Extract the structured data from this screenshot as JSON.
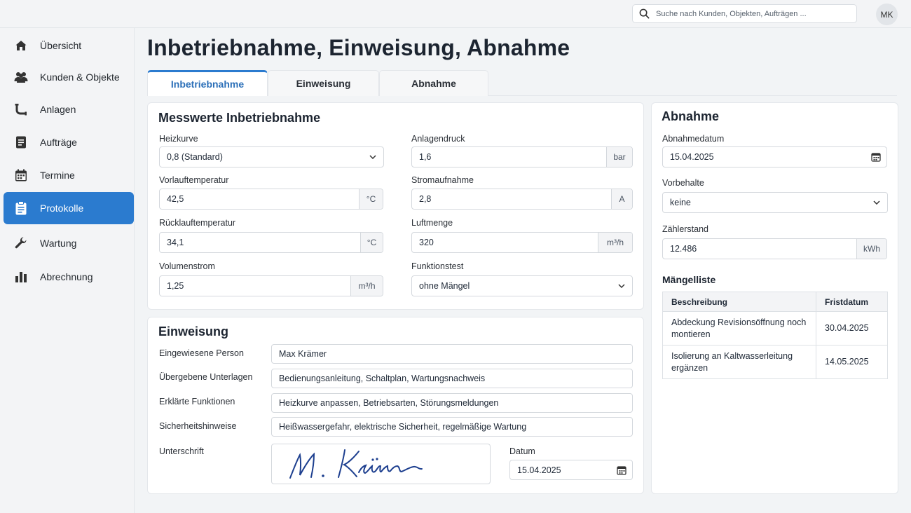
{
  "search": {
    "placeholder": "Suche nach Kunden, Objekten, Aufträgen ..."
  },
  "user": {
    "initials": "MK"
  },
  "sidebar": {
    "items": [
      {
        "label": "Übersicht",
        "icon": "home-icon"
      },
      {
        "label": "Kunden & Objekte",
        "icon": "users-icon"
      },
      {
        "label": "Anlagen",
        "icon": "pipe-icon"
      },
      {
        "label": "Aufträge",
        "icon": "document-icon"
      },
      {
        "label": "Termine",
        "icon": "calendar-icon"
      },
      {
        "label": "Protokolle",
        "icon": "clipboard-icon",
        "active": true
      },
      {
        "label": "Wartung",
        "icon": "wrench-icon"
      },
      {
        "label": "Abrechnung",
        "icon": "bar-chart-icon"
      }
    ]
  },
  "page": {
    "title": "Inbetriebnahme, Einweisung, Abnahme"
  },
  "tabs": [
    {
      "label": "Inbetriebnahme",
      "active": true
    },
    {
      "label": "Einweisung"
    },
    {
      "label": "Abnahme"
    }
  ],
  "measurements": {
    "title": "Messwerte Inbetriebnahme",
    "heizkurve": {
      "label": "Heizkurve",
      "value": "0,8 (Standard)"
    },
    "vorlauf": {
      "label": "Vorlauftemperatur",
      "value": "42,5",
      "unit": "°C"
    },
    "ruecklauf": {
      "label": "Rücklauftemperatur",
      "value": "34,1",
      "unit": "°C"
    },
    "volumenstrom": {
      "label": "Volumenstrom",
      "value": "1,25",
      "unit": "m³/h"
    },
    "anlagendruck": {
      "label": "Anlagendruck",
      "value": "1,6",
      "unit": "bar"
    },
    "stromaufnahme": {
      "label": "Stromaufnahme",
      "value": "2,8",
      "unit": "A"
    },
    "luftmenge": {
      "label": "Luftmenge",
      "value": "320",
      "unit": "m³/h"
    },
    "funktionstest": {
      "label": "Funktionstest",
      "value": "ohne Mängel"
    }
  },
  "instruction": {
    "title": "Einweisung",
    "person": {
      "label": "Eingewiesene Person",
      "value": "Max Krämer"
    },
    "documents": {
      "label": "Übergebene Unterlagen",
      "value": "Bedienungsanleitung, Schaltplan, Wartungsnachweis"
    },
    "functions": {
      "label": "Erklärte Funktionen",
      "value": "Heizkurve anpassen, Betriebsarten, Störungsmeldungen"
    },
    "safety": {
      "label": "Sicherheitshinweise",
      "value": "Heißwassergefahr, elektrische Sicherheit, regelmäßige Wartung"
    },
    "signature": {
      "label": "Unterschrift",
      "text": "M. Krämer"
    },
    "date": {
      "label": "Datum",
      "value": "15.04.2025"
    }
  },
  "acceptance": {
    "title": "Abnahme",
    "date": {
      "label": "Abnahmedatum",
      "value": "15.04.2025"
    },
    "reservations": {
      "label": "Vorbehalte",
      "value": "keine"
    },
    "meter": {
      "label": "Zählerstand",
      "value": "12.486",
      "unit": "kWh"
    },
    "defects": {
      "title": "Mängelliste",
      "headers": [
        "Beschreibung",
        "Fristdatum"
      ],
      "rows": [
        [
          "Abdeckung Revisionsöffnung noch montieren",
          "30.04.2025"
        ],
        [
          "Isolierung an Kaltwasserleitung ergänzen",
          "14.05.2025"
        ]
      ]
    }
  }
}
